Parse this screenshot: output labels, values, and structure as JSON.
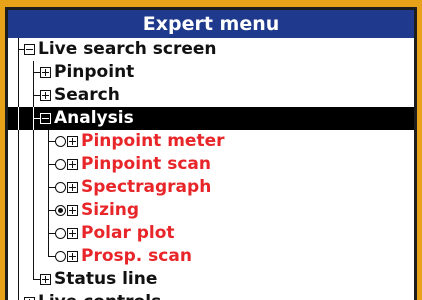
{
  "title": "Expert menu",
  "tree": [
    {
      "label": "Live search screen",
      "state": "expanded"
    },
    {
      "label": "Pinpoint",
      "state": "collapsed"
    },
    {
      "label": "Search",
      "state": "collapsed"
    },
    {
      "label": "Analysis",
      "state": "expanded",
      "selected": true
    },
    {
      "label": "Pinpoint meter",
      "radio": "unchecked"
    },
    {
      "label": "Pinpoint scan",
      "radio": "unchecked"
    },
    {
      "label": "Spectragraph",
      "radio": "unchecked"
    },
    {
      "label": "Sizing",
      "radio": "checked"
    },
    {
      "label": "Polar plot",
      "radio": "unchecked"
    },
    {
      "label": "Prosp. scan",
      "radio": "unchecked"
    },
    {
      "label": "Status line",
      "state": "collapsed"
    },
    {
      "label": "Live controls",
      "state": "collapsed"
    }
  ],
  "colors": {
    "title_bg": "#1f3a8c",
    "frame": "#e8a21a",
    "mode_text": "#e8262a",
    "selected_bg": "#000000"
  }
}
